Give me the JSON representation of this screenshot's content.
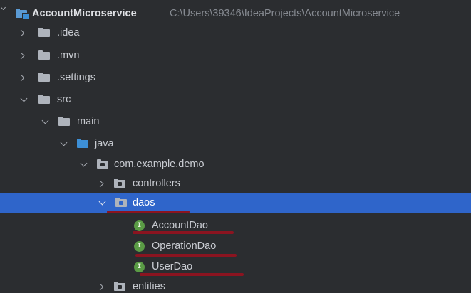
{
  "project_tree": {
    "root": {
      "label": "AccountMicroservice",
      "path": "C:\\Users\\39346\\IdeaProjects\\AccountMicroservice"
    },
    "items": [
      {
        "label": ".idea"
      },
      {
        "label": ".mvn"
      },
      {
        "label": ".settings"
      },
      {
        "label": "src"
      },
      {
        "label": "main"
      },
      {
        "label": "java"
      },
      {
        "label": "com.example.demo"
      },
      {
        "label": "controllers"
      },
      {
        "label": "daos"
      },
      {
        "label": "AccountDao",
        "icon_letter": "I"
      },
      {
        "label": "OperationDao",
        "icon_letter": "I"
      },
      {
        "label": "UserDao",
        "icon_letter": "I"
      },
      {
        "label": "entities"
      }
    ],
    "selected_item": "daos"
  },
  "colors": {
    "background": "#2b2d30",
    "selection": "#2f65ca",
    "annotation_underline": "#8b1420",
    "interface_icon": "#5a9b45",
    "source_folder": "#3d8fd6"
  }
}
